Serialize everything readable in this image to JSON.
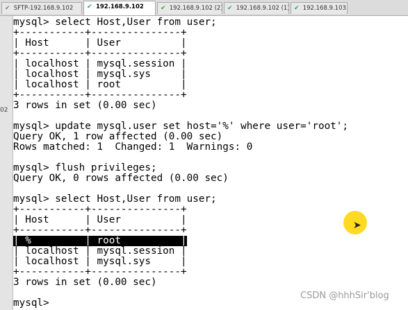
{
  "tabs": [
    {
      "label": "SFTP-192.168.9.102",
      "icon": "tab-check-icon"
    },
    {
      "label": "192.168.9.102",
      "icon": "tab-check-icon",
      "active": true
    },
    {
      "label": "192.168.9.102 (2)",
      "icon": "tab-check-icon"
    },
    {
      "label": "192.168.9.102 (1)",
      "icon": "tab-check-icon"
    },
    {
      "label": "192.168.9.103",
      "icon": "tab-check-icon"
    }
  ],
  "gutter_mark": "02",
  "terminal": {
    "lines": [
      "mysql> select Host,User from user;",
      "+-----------+---------------+",
      "| Host      | User          |",
      "+-----------+---------------+",
      "| localhost | mysql.session |",
      "| localhost | mysql.sys     |",
      "| localhost | root          |",
      "+-----------+---------------+",
      "3 rows in set (0.00 sec)",
      "",
      "mysql> update mysql.user set host='%' where user='root';",
      "Query OK, 1 row affected (0.00 sec)",
      "Rows matched: 1  Changed: 1  Warnings: 0",
      "",
      "mysql> flush privileges;",
      "Query OK, 0 rows affected (0.00 sec)",
      "",
      "mysql> select Host,User from user;",
      "+-----------+---------------+",
      "| Host      | User          |",
      "+-----------+---------------+",
      "| %         | root          |",
      "| localhost | mysql.session |",
      "| localhost | mysql.sys     |",
      "+-----------+---------------+",
      "3 rows in set (0.00 sec)",
      "",
      "mysql> "
    ],
    "selected_line": 21
  },
  "watermark": "CSDN @hhhSir'blog",
  "colors": {
    "selection_bg": "#000000",
    "cursor_highlight": "#ffd60a",
    "tab_icon": "#2ba84a"
  }
}
